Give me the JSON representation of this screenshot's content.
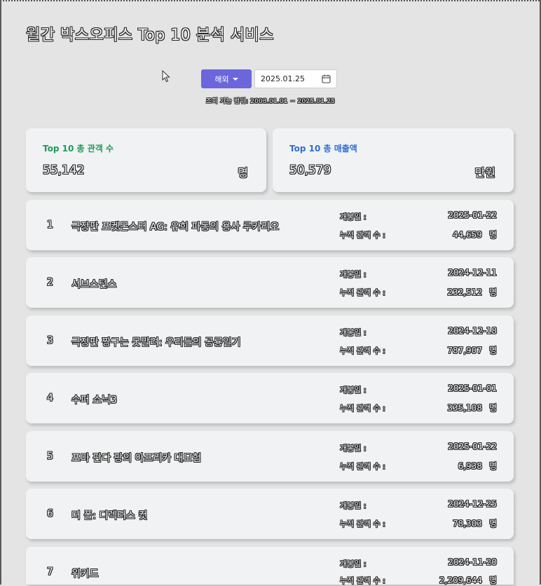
{
  "page": {
    "title": "월간 박스오피스 Top 10 분석 서비스"
  },
  "controls": {
    "region_label": "해외",
    "date_value": "2025.01.25",
    "range_hint": "조회 가능 범위: 2003.01.01 ~ 2025.01.25"
  },
  "summary": {
    "audience_label": "Top 10 총 관객 수",
    "audience_value": "55,142",
    "audience_unit": "명",
    "sales_label": "Top 10 총 매출액",
    "sales_value": "50,579",
    "sales_unit": "만원"
  },
  "meta_labels": {
    "open_date": "개봉일 :",
    "audience": "누적 관객 수 :",
    "unit": "명"
  },
  "movies": [
    {
      "rank": "1",
      "title": "극장판 포켓몬스터 AG: 유희 파동의 용사 루카리오",
      "open_date": "2025-01-22",
      "audience": "44,659"
    },
    {
      "rank": "2",
      "title": "서브스턴스",
      "open_date": "2024-12-11",
      "audience": "232,512"
    },
    {
      "rank": "3",
      "title": "극장판 짱구는 못말려: 우리들의 공룡일기",
      "open_date": "2024-12-18",
      "audience": "787,907"
    },
    {
      "rank": "4",
      "title": "수퍼 소닉3",
      "open_date": "2025-01-01",
      "audience": "335,108"
    },
    {
      "rank": "5",
      "title": "포마 판다 팡의 아프리카 대모험",
      "open_date": "2025-01-22",
      "audience": "6,938"
    },
    {
      "rank": "6",
      "title": "더 폴: 디렉터스 컷",
      "open_date": "2024-12-25",
      "audience": "78,303"
    },
    {
      "rank": "7",
      "title": "위키드",
      "open_date": "2024-11-20",
      "audience": "2,209,644"
    }
  ],
  "colors": {
    "accent_button": "#6b66dc",
    "audience_label": "#1f9a58",
    "sales_label": "#2f6fd1",
    "background": "#e4e4e4",
    "card": "#f1f2f4"
  },
  "icons": {
    "calendar": "calendar-icon",
    "cursor": "mouse-pointer-icon",
    "dropdown": "caret-down-icon"
  }
}
